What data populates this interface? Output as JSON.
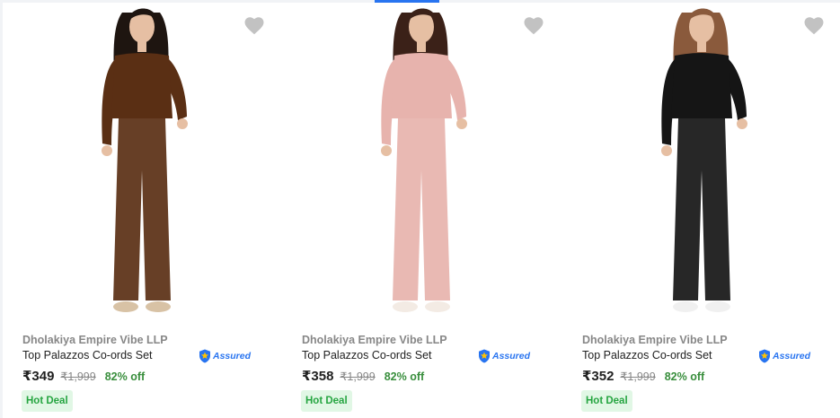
{
  "products": [
    {
      "brand": "Dholakiya Empire Vibe LLP",
      "title": "Top Palazzos Co-ords Set",
      "price": "₹349",
      "mrp": "₹1,999",
      "discount": "82% off",
      "badge": "Hot Deal",
      "assured": "Assured",
      "outfit_color": "#5a2f14",
      "hair_color": "#1e1510",
      "shoe_color": "#d8c2a5"
    },
    {
      "brand": "Dholakiya Empire Vibe LLP",
      "title": "Top Palazzos Co-ords Set",
      "price": "₹358",
      "mrp": "₹1,999",
      "discount": "82% off",
      "badge": "Hot Deal",
      "assured": "Assured",
      "outfit_color": "#e7b3ad",
      "hair_color": "#3b2118",
      "shoe_color": "#f3ebe4"
    },
    {
      "brand": "Dholakiya Empire Vibe LLP",
      "title": "Top Palazzos Co-ords Set",
      "price": "₹352",
      "mrp": "₹1,999",
      "discount": "82% off",
      "badge": "Hot Deal",
      "assured": "Assured",
      "outfit_color": "#151515",
      "hair_color": "#8a5a3c",
      "shoe_color": "#f0f0f0"
    }
  ],
  "colors": {
    "heart": "#c2c2c2",
    "accent": "#2874f0",
    "discount": "#388e3c",
    "deal_bg": "#e1f7e5"
  }
}
